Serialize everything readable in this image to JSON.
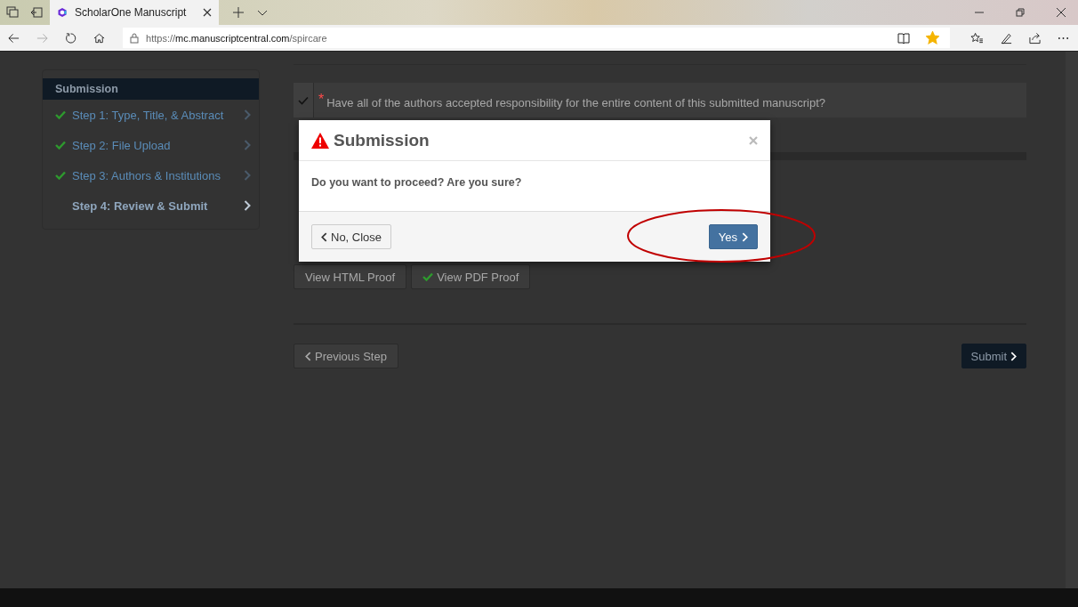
{
  "browser": {
    "tab_title": "ScholarOne Manuscript",
    "url_host": "mc.manuscriptcentral.com",
    "url_scheme": "https://",
    "url_path": "/spircare",
    "favorite": true
  },
  "sidebar": {
    "title": "Submission",
    "steps": [
      {
        "label": "Step 1: Type, Title, & Abstract",
        "completed": true,
        "selected": false
      },
      {
        "label": "Step 2: File Upload",
        "completed": true,
        "selected": false
      },
      {
        "label": "Step 3: Authors & Institutions",
        "completed": true,
        "selected": false
      },
      {
        "label": "Step 4: Review & Submit",
        "completed": false,
        "selected": true
      }
    ]
  },
  "question": {
    "text": "Have all of the authors accepted responsibility for the entire content of this submitted manuscript?",
    "required_mark": "*",
    "checked": true
  },
  "proofs": [
    {
      "label": "View HTML Proof",
      "checked": false
    },
    {
      "label": "View PDF Proof",
      "checked": true
    }
  ],
  "navigation": {
    "previous": "Previous Step",
    "submit": "Submit"
  },
  "dialog": {
    "title": "Submission",
    "message": "Do you want to proceed? Are you sure?",
    "cancel": "No, Close",
    "confirm": "Yes",
    "confirm_highlighted": true
  }
}
